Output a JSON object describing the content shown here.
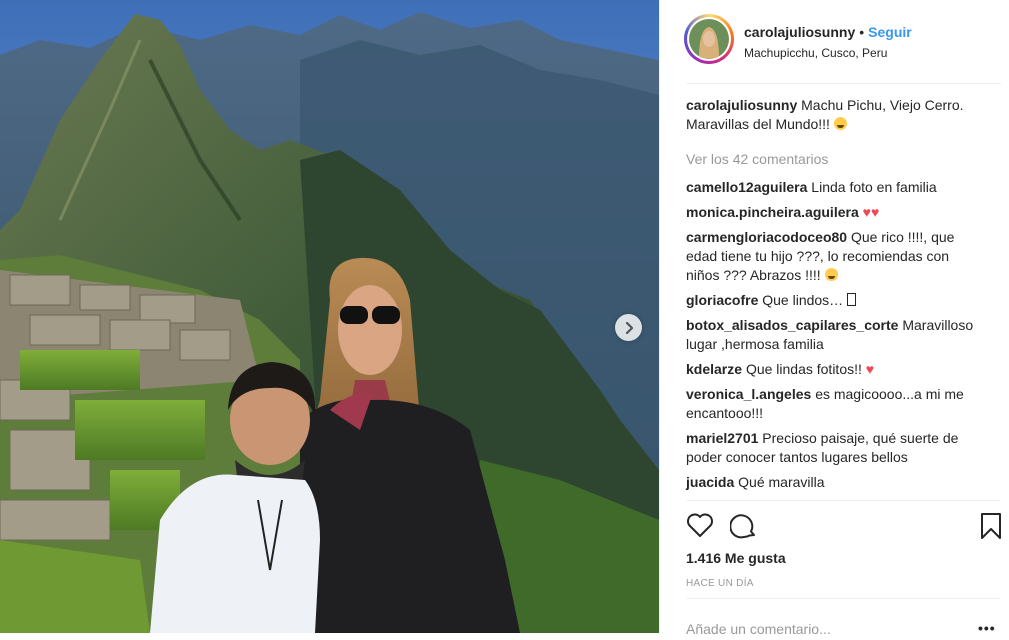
{
  "post": {
    "username": "carolajuliosunny",
    "separator": "•",
    "follow_label": "Seguir",
    "location": "Machupicchu, Cusco, Peru"
  },
  "caption": {
    "username": "carolajuliosunny",
    "text": "Machu Pichu, Viejo Cerro. Maravillas del Mundo!!!",
    "emoji": "smiling-face-with-heart-eyes"
  },
  "view_all_comments": "Ver los 42 comentarios",
  "comments": [
    {
      "username": "camello12aguilera",
      "text": "Linda foto en familia"
    },
    {
      "username": "monica.pincheira.aguilera",
      "text": "",
      "suffix": "♥♥"
    },
    {
      "username": "carmengloriacodoceo80",
      "text": "Que rico !!!!, que edad tiene tu hijo ???, lo recomiendas con niños ??? Abrazos !!!!",
      "emoji": "astonished-face"
    },
    {
      "username": "gloriacofre",
      "text": "Que lindos… ",
      "glyph": "missing-glyph"
    },
    {
      "username": "botox_alisados_capilares_corte",
      "text": "Maravilloso lugar ,hermosa familia"
    },
    {
      "username": "kdelarze",
      "text": "Que lindas fotitos!!",
      "suffix": "♥"
    },
    {
      "username": "veronica_l.angeles",
      "text": "es magicoooo...a mi me encantooo!!!"
    },
    {
      "username": "mariel2701",
      "text": "Precioso paisaje, qué suerte de poder conocer tantos lugares bellos"
    },
    {
      "username": "juacida",
      "text": "Qué maravilla"
    }
  ],
  "likes_text": "1.416 Me gusta",
  "time_ago": "HACE UN DÍA",
  "add_comment_placeholder": "Añade un comentario...",
  "more_options": "•••",
  "icons": {
    "like": "heart-outline-icon",
    "comment": "comment-bubble-icon",
    "save": "bookmark-icon",
    "next": "chevron-right-icon"
  },
  "colors": {
    "link_blue": "#3897f0",
    "heart_red": "#ed4956",
    "muted": "#999999",
    "text": "#262626",
    "divider": "#efefef"
  }
}
